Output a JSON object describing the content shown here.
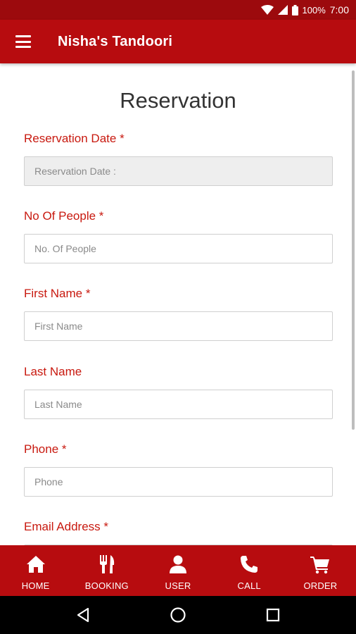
{
  "status_bar": {
    "battery": "100%",
    "time": "7:00"
  },
  "app_bar": {
    "title": "Nisha's Tandoori"
  },
  "page": {
    "title": "Reservation"
  },
  "form": {
    "fields": [
      {
        "label": "Reservation Date *",
        "placeholder": "Reservation Date :",
        "value": ""
      },
      {
        "label": "No Of People *",
        "placeholder": "No. Of People",
        "value": ""
      },
      {
        "label": "First Name *",
        "placeholder": "First Name",
        "value": ""
      },
      {
        "label": "Last Name",
        "placeholder": "Last Name",
        "value": ""
      },
      {
        "label": "Phone *",
        "placeholder": "Phone",
        "value": ""
      },
      {
        "label": "Email Address *",
        "placeholder": "",
        "value": ""
      }
    ]
  },
  "bottom_nav": {
    "items": [
      {
        "label": "HOME",
        "icon": "home-icon"
      },
      {
        "label": "BOOKING",
        "icon": "cutlery-icon"
      },
      {
        "label": "USER",
        "icon": "user-icon"
      },
      {
        "label": "CALL",
        "icon": "phone-icon"
      },
      {
        "label": "ORDER",
        "icon": "cart-icon"
      }
    ]
  },
  "colors": {
    "primary": "#b70c0f",
    "status_bar": "#9c0a0d",
    "label": "#c8190f"
  }
}
